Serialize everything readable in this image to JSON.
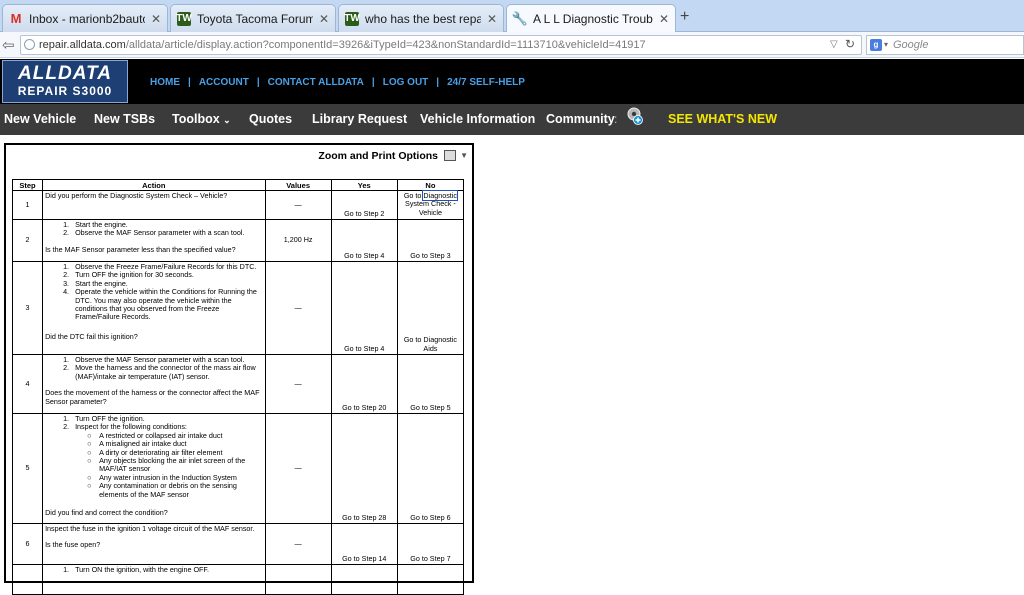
{
  "browser": {
    "tabs": [
      {
        "title": "Inbox - marionb2bauto@g...",
        "icon": "gmail-icon"
      },
      {
        "title": "Toyota Tacoma Forums - ...",
        "icon": "forum-icon"
      },
      {
        "title": "who has the best repair ma...",
        "icon": "forum-icon"
      },
      {
        "title": "A L L Diagnostic Trouble C...",
        "icon": "wrench-icon",
        "active": true
      }
    ],
    "url_host": "repair.alldata.com",
    "url_path": "/alldata/article/display.action?componentId=3926&iTypeId=423&nonStandardId=1113710&vehicleId=41917",
    "search_placeholder": "Google"
  },
  "header": {
    "logo_line1": "ALLDATA",
    "logo_line2": "REPAIR S3000",
    "links": [
      "HOME",
      "ACCOUNT",
      "CONTACT ALLDATA",
      "LOG OUT",
      "24/7 SELF-HELP"
    ]
  },
  "menu": {
    "items": [
      "New Vehicle",
      "New TSBs",
      "Toolbox",
      "Quotes",
      "Library Request",
      "Vehicle Information",
      "Community"
    ],
    "whats_new": "SEE WHAT'S NEW"
  },
  "doc": {
    "zoom_label": "Zoom and Print Options",
    "columns": [
      "Step",
      "Action",
      "Values",
      "Yes",
      "No"
    ],
    "dash": "—",
    "s1": {
      "num": "1",
      "q": "Did you perform the Diagnostic System Check – Vehicle?",
      "yes": "Go to Step 2",
      "no_a": "Go to ",
      "no_b": "Diagnostic",
      "no_c": "System Check - Vehicle"
    },
    "s2": {
      "num": "2",
      "i1": "Start the engine.",
      "i2": "Observe the MAF Sensor parameter with a scan tool.",
      "q": "Is the MAF Sensor parameter less than the specified value?",
      "val": "1,200 Hz",
      "yes": "Go to Step 4",
      "no": "Go to Step 3"
    },
    "s3": {
      "num": "3",
      "i1": "Observe the Freeze Frame/Failure Records for this DTC.",
      "i2": "Turn OFF the ignition for 30 seconds.",
      "i3": "Start the engine.",
      "i4": "Operate the vehicle within the Conditions for Running the DTC. You may also operate the vehicle within the conditions that you observed from the Freeze Frame/Failure Records.",
      "q": "Did the DTC fail this ignition?",
      "yes": "Go to Step 4",
      "no": "Go to Diagnostic Aids"
    },
    "s4": {
      "num": "4",
      "i1": "Observe the MAF Sensor parameter with a scan tool.",
      "i2": "Move the harness and the connector of the mass air flow (MAF)/intake air temperature (IAT) sensor.",
      "q": "Does the movement of the harness or the connector affect the MAF Sensor parameter?",
      "yes": "Go to Step 20",
      "no": "Go to Step 5"
    },
    "s5": {
      "num": "5",
      "i1": "Turn OFF the ignition.",
      "i2": "Inspect for the following conditions:",
      "subs": [
        "A restricted or collapsed air intake duct",
        "A misaligned air intake duct",
        "A dirty or deteriorating air filter element",
        "Any objects blocking the air inlet screen of the MAF/IAT sensor",
        "Any water intrusion in the Induction System",
        "Any contamination or debris on the sensing elements of the MAF sensor"
      ],
      "q": "Did you find and correct the condition?",
      "yes": "Go to Step 28",
      "no": "Go to Step 6"
    },
    "s6": {
      "num": "6",
      "t": "Inspect the fuse in the ignition 1 voltage circuit of the MAF sensor.",
      "q": "Is the fuse open?",
      "yes": "Go to Step 14",
      "no": "Go to Step 7"
    },
    "s7": {
      "i1": "Turn ON the ignition, with the engine OFF."
    }
  }
}
